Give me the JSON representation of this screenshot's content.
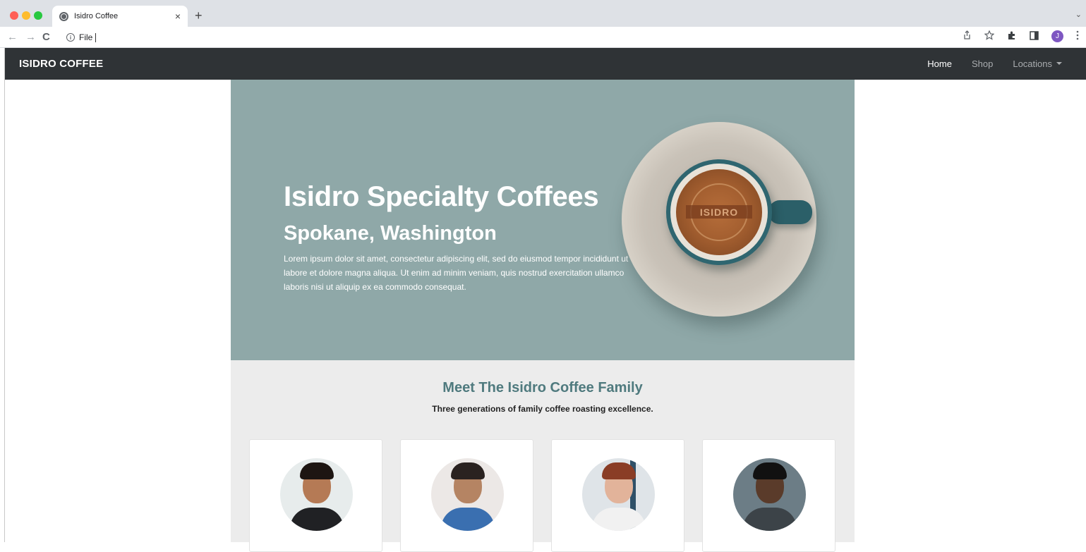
{
  "browser": {
    "tab_title": "Isidro Coffee",
    "tab_close": "×",
    "new_tab": "+",
    "tab_menu": "⌄",
    "nav_back": "←",
    "nav_forward": "→",
    "nav_reload": "C",
    "address_info": "i",
    "address_text": "File",
    "profile_initial": "J",
    "icons": [
      "share-icon",
      "star-icon",
      "extensions-icon",
      "sidepanel-icon",
      "profile-avatar",
      "menu-icon"
    ]
  },
  "site": {
    "brand": "ISIDRO COFFEE",
    "nav": [
      {
        "label": "Home",
        "active": true
      },
      {
        "label": "Shop",
        "active": false
      },
      {
        "label": "Locations",
        "active": false,
        "dropdown": true
      }
    ]
  },
  "hero": {
    "title": "Isidro Specialty Coffees",
    "subtitle": "Spokane, Washington",
    "text": "Lorem ipsum dolor sit amet, consectetur adipiscing elit, sed do eiusmod tempor incididunt ut labore et dolore magna aliqua. Ut enim ad minim veniam, quis nostrud exercitation ullamco laboris nisi ut aliquip ex ea commodo consequat.",
    "cup_logo": "ISIDRO",
    "background_color": "#8fa8a8"
  },
  "family": {
    "title": "Meet The Isidro Coffee Family",
    "subtitle": "Three generations of family coffee roasting excellence."
  },
  "colors": {
    "navbar": "#2f3336",
    "accent_teal": "#4f7a7e",
    "section_bg": "#ececec"
  }
}
